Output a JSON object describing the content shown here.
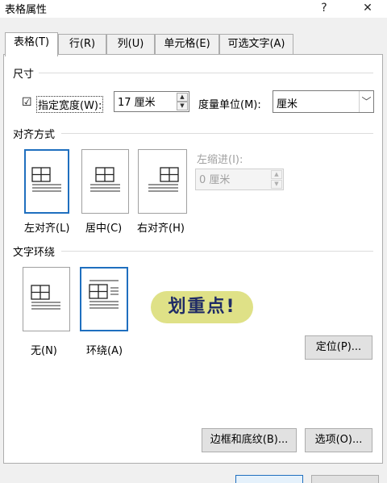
{
  "window": {
    "title": "表格属性",
    "help_glyph": "?",
    "close_glyph": "✕"
  },
  "tabs": [
    {
      "label": "表格(T)",
      "active": true
    },
    {
      "label": "行(R)",
      "active": false
    },
    {
      "label": "列(U)",
      "active": false
    },
    {
      "label": "单元格(E)",
      "active": false
    },
    {
      "label": "可选文字(A)",
      "active": false
    }
  ],
  "size": {
    "group_title": "尺寸",
    "preferred_width_checked": true,
    "check_glyph": "☑",
    "preferred_width_label": "指定宽度(W):",
    "width_value": "17 厘米",
    "measure_label": "度量单位(M):",
    "measure_value": "厘米"
  },
  "alignment": {
    "group_title": "对齐方式",
    "options": [
      {
        "label": "左对齐(L)",
        "selected": true
      },
      {
        "label": "居中(C)",
        "selected": false
      },
      {
        "label": "右对齐(H)",
        "selected": false
      }
    ],
    "indent_label": "左缩进(I):",
    "indent_value": "0 厘米"
  },
  "wrapping": {
    "group_title": "文字环绕",
    "options": [
      {
        "label": "无(N)",
        "selected": false
      },
      {
        "label": "环绕(A)",
        "selected": true
      }
    ],
    "positioning_button": "定位(P)..."
  },
  "annotation": {
    "text": "划重点!",
    "color": "#dfe187"
  },
  "footer": {
    "borders_button": "边框和底纹(B)...",
    "options_button": "选项(O)..."
  },
  "colors": {
    "accent": "#1f6fbf"
  }
}
